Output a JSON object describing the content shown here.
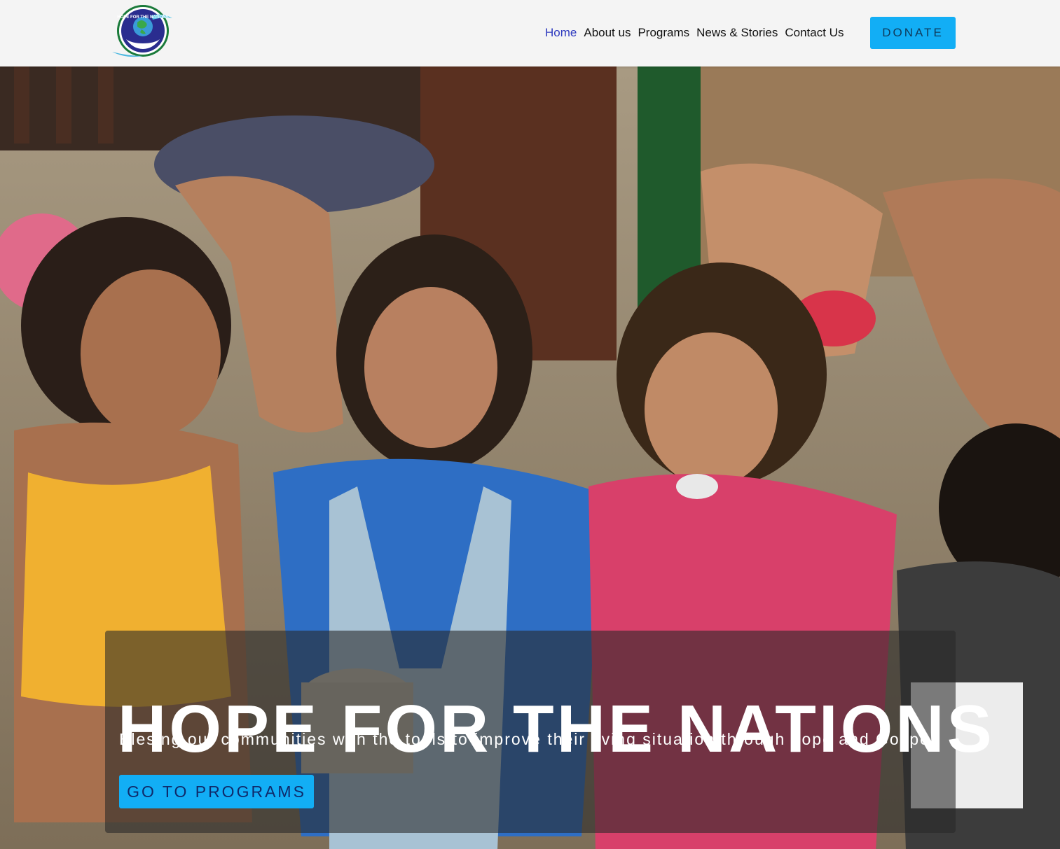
{
  "brand": {
    "logo_text": "HOPE FOR THE NATIONS"
  },
  "nav": {
    "items": [
      {
        "label": "Home",
        "active": true
      },
      {
        "label": "About us",
        "active": false
      },
      {
        "label": "Programs",
        "active": false
      },
      {
        "label": "News & Stories",
        "active": false
      },
      {
        "label": "Contact Us",
        "active": false
      }
    ],
    "donate_label": "DONATE"
  },
  "hero": {
    "title": "HOPE FOR THE NATIONS",
    "subtitle": "Blesing our communities with the tools to improve their living situation through hope and Gospel",
    "cta_label": "GO TO PROGRAMS",
    "image_icon": "children-eating-photo"
  },
  "colors": {
    "accent": "#12aef5",
    "nav_active": "#2f3bbf",
    "header_bg": "#f4f4f4"
  }
}
